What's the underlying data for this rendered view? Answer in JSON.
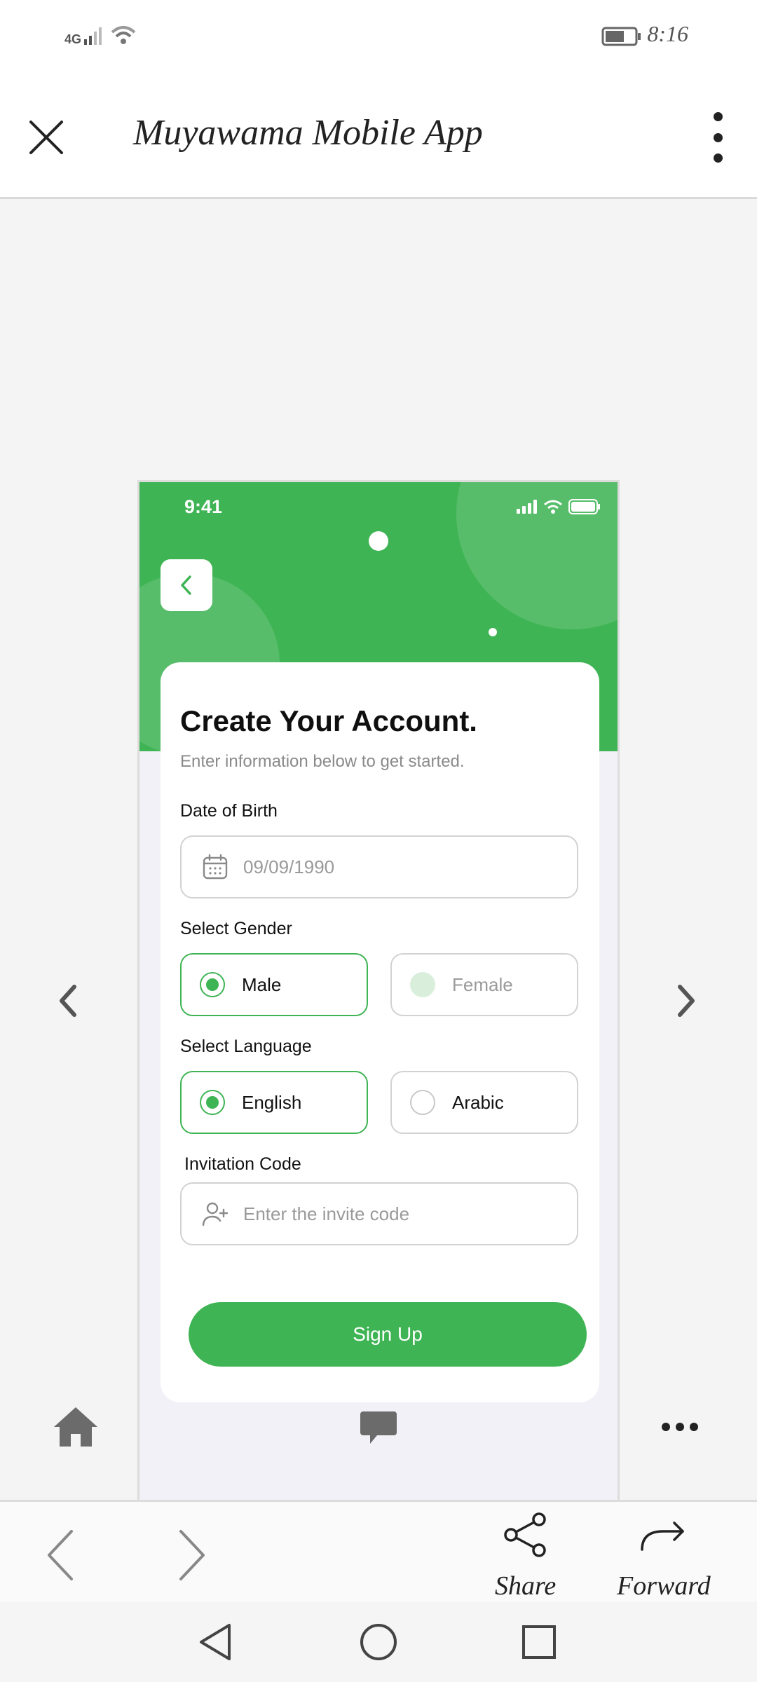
{
  "status_bar": {
    "network": "4G",
    "time": "8:16"
  },
  "header": {
    "title": "Muyawama Mobile App"
  },
  "phone": {
    "time": "9:41",
    "form": {
      "title": "Create Your Account.",
      "subtitle": "Enter information below to get started.",
      "dob_label": "Date of Birth",
      "dob_value": "09/09/1990",
      "gender_label": "Select Gender",
      "gender_options": [
        "Male",
        "Female"
      ],
      "gender_selected": "Male",
      "language_label": "Select Language",
      "language_options": [
        "English",
        "Arabic"
      ],
      "language_selected": "English",
      "invite_label": "Invitation Code",
      "invite_placeholder": "Enter the invite code",
      "submit_label": "Sign Up"
    }
  },
  "bottom_nav": {
    "share_label": "Share",
    "forward_label": "Forward"
  },
  "colors": {
    "accent": "#3fb454",
    "icon_gray": "#6b6b6b"
  }
}
